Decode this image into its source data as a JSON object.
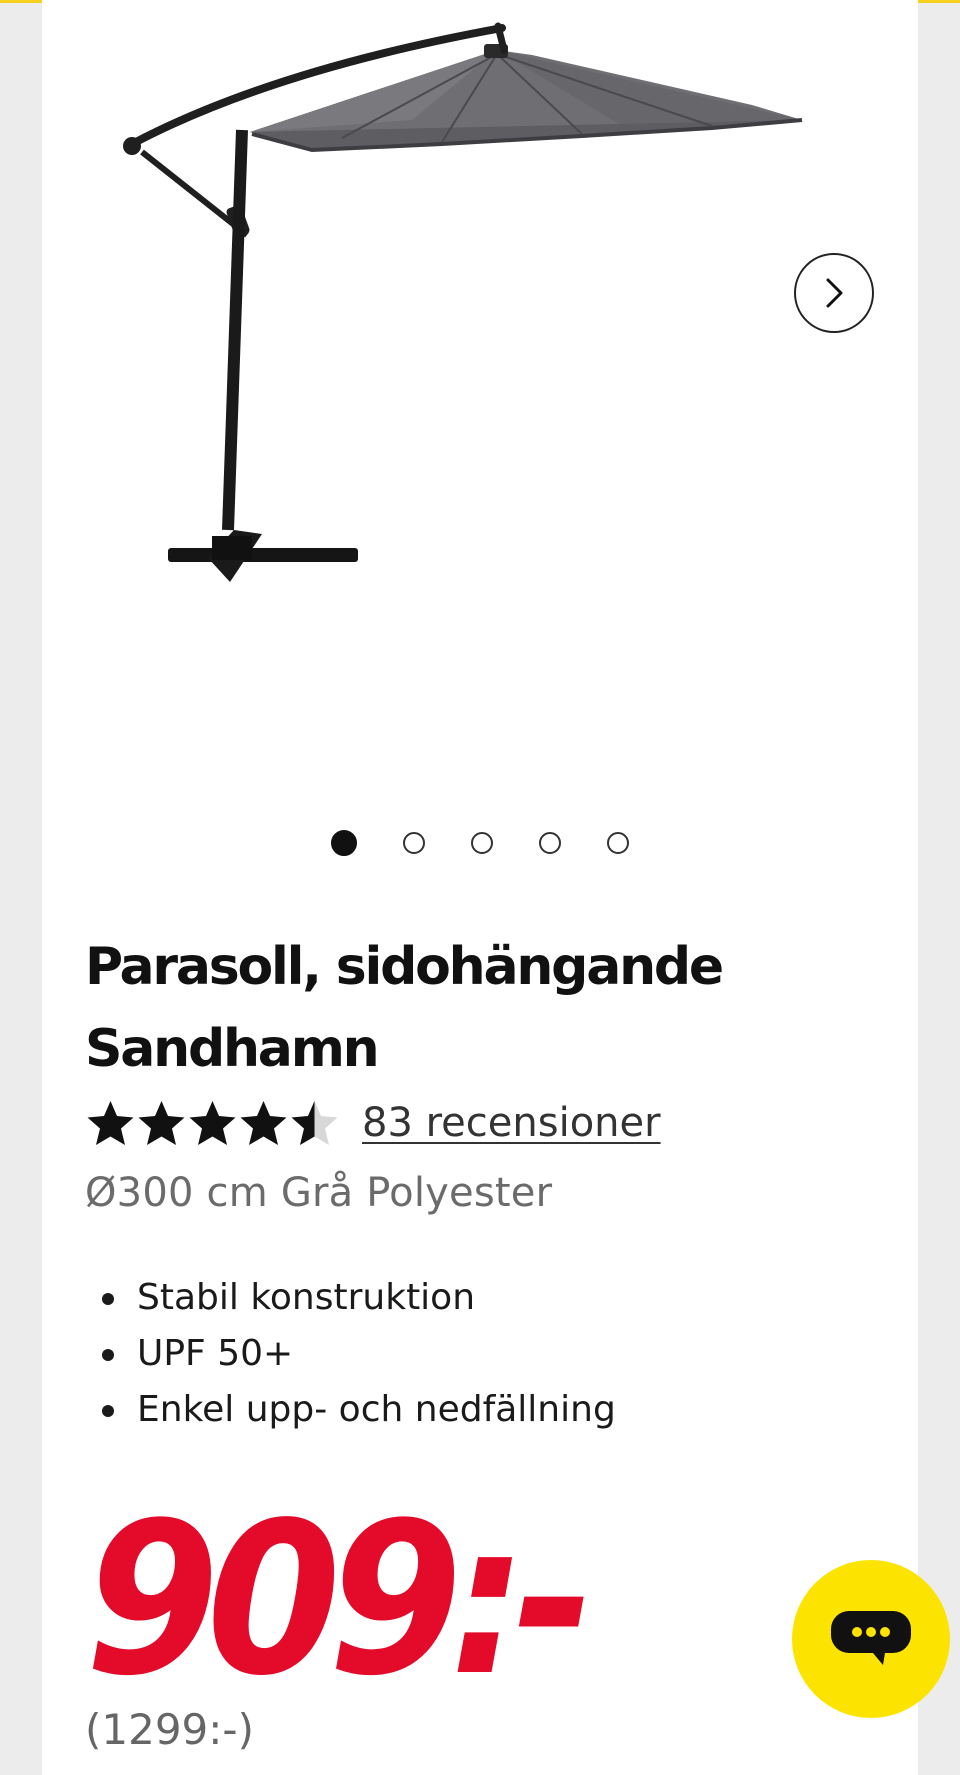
{
  "colors": {
    "accent_yellow": "#fde300",
    "price_red": "#e30a2a",
    "text_dark": "#111111",
    "text_muted": "#6b6b6b"
  },
  "gallery": {
    "image_alt": "Parasoll, sidohängande Sandhamn",
    "image_icon": "cantilever-parasol-image",
    "next_icon": "chevron-right-icon",
    "slide_count": 5,
    "active_slide": 1
  },
  "product": {
    "title": "Parasoll, sidohängande Sandhamn",
    "rating": 4.5,
    "rating_max": 5,
    "reviews_label": "83 recensioner",
    "subtitle": "Ø300 cm Grå Polyester",
    "features": [
      "Stabil konstruktion",
      "UPF 50+",
      "Enkel upp- och nedfällning"
    ]
  },
  "pricing": {
    "price": "909:-",
    "old_price": "(1299:-)"
  },
  "chat": {
    "icon": "chat-bubble-icon"
  }
}
